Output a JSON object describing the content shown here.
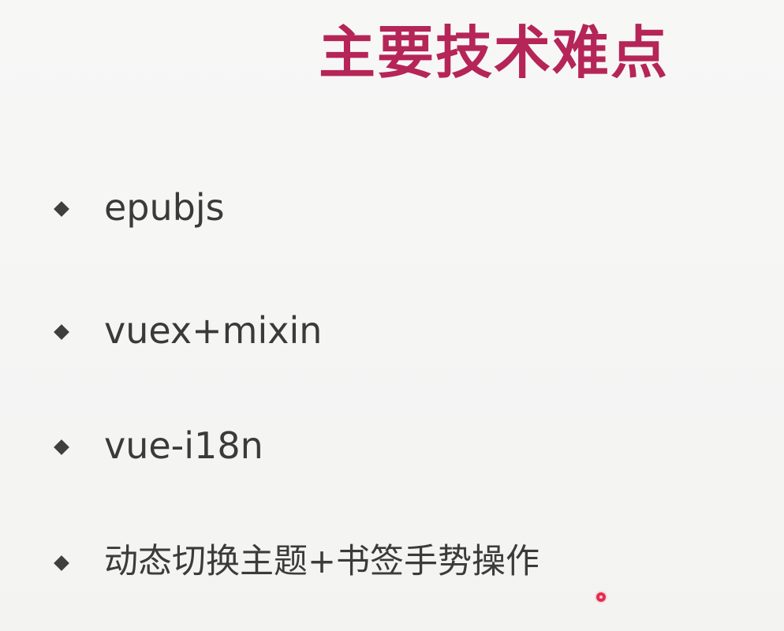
{
  "slide": {
    "title": "主要技术难点",
    "bullets": [
      "epubjs",
      "vuex+mixin",
      "vue-i18n",
      "动态切换主题+书签手势操作"
    ]
  },
  "colors": {
    "background": "#f5f5f4",
    "title": "#b52557",
    "text": "#3a3a3a",
    "cursor": "#e42c4d"
  },
  "icons": {
    "bullet": "diamond-bullet-icon",
    "pointer": "cursor-dot-icon"
  }
}
